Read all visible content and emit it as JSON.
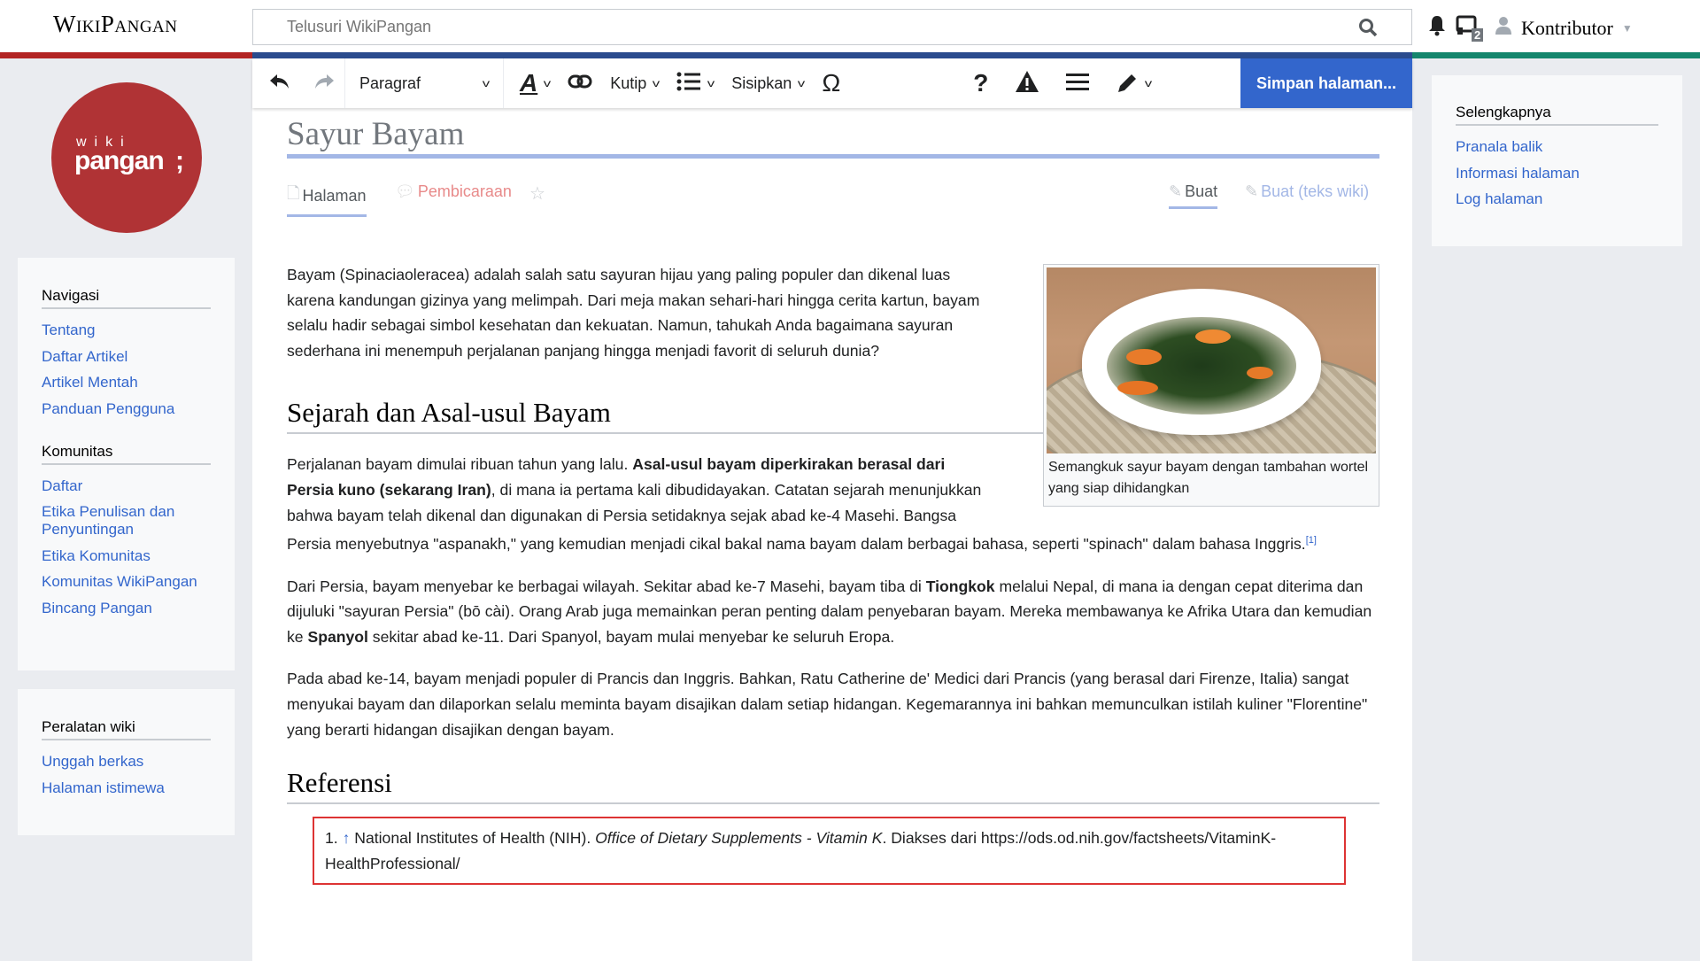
{
  "header": {
    "brand": "WikiPangan",
    "search_placeholder": "Telusuri WikiPangan",
    "notifications_count": "2",
    "username": "Kontributor"
  },
  "colors": {
    "red": "#b32424",
    "blue": "#2a4b8d",
    "green": "#14866d",
    "accent": "#3366cc"
  },
  "logo": {
    "text_top": "wiki",
    "text_main": "pangan;"
  },
  "sidebar": {
    "sections": [
      {
        "title": "Navigasi",
        "items": [
          "Tentang",
          "Daftar Artikel",
          "Artikel Mentah",
          "Panduan Pengguna"
        ]
      },
      {
        "title": "Komunitas",
        "items": [
          "Daftar",
          "Etika Penulisan dan Penyuntingan",
          "Etika Komunitas",
          "Komunitas WikiPangan",
          "Bincang Pangan"
        ]
      },
      {
        "title": "Peralatan wiki",
        "items": [
          "Unggah berkas",
          "Halaman istimewa"
        ]
      }
    ]
  },
  "right_panel": {
    "title": "Selengkapnya",
    "items": [
      "Pranala balik",
      "Informasi halaman",
      "Log halaman"
    ]
  },
  "toolbar": {
    "paragraph": "Paragraf",
    "cite": "Kutip",
    "insert": "Sisipkan",
    "save": "Simpan halaman..."
  },
  "page": {
    "title": "Sayur Bayam",
    "tabs": {
      "page": "Halaman",
      "talk": "Pembicaraan",
      "edit": "Buat",
      "edit_source": "Buat (teks wiki)"
    },
    "figure_caption": "Semangkuk sayur bayam dengan tambahan wortel yang siap dihidangkan",
    "intro": "Bayam (Spinaciaoleracea) adalah salah satu sayuran hijau yang paling populer dan dikenal luas karena kandungan gizinya yang melimpah. Dari meja makan sehari-hari hingga cerita kartun, bayam selalu hadir sebagai simbol kesehatan dan kekuatan. Namun, tahukah Anda bagaimana sayuran sederhana ini menempuh perjalanan panjang hingga menjadi favorit di seluruh dunia?",
    "h2_history": "Sejarah dan Asal-usul Bayam",
    "p1": {
      "a": "Perjalanan bayam dimulai ribuan tahun yang lalu. ",
      "b": "Asal-usul bayam diperkirakan berasal dari Persia kuno (sekarang Iran)",
      "c": ", di mana ia pertama kali dibudidayakan. Catatan sejarah menunjukkan bahwa bayam telah dikenal dan digunakan di Persia setidaknya sejak abad ke-4 Masehi. Bangsa Persia menyebutnya \"aspanakh,\" yang kemudian menjadi cikal bakal nama bayam dalam berbagai bahasa, seperti \"spinach\" dalam bahasa Inggris.",
      "ref": "[1]"
    },
    "p2": {
      "a": "Dari Persia, bayam menyebar ke berbagai wilayah. Sekitar abad ke-7 Masehi, bayam tiba di ",
      "b": "Tiongkok",
      "c": " melalui Nepal, di mana ia dengan cepat diterima dan dijuluki \"sayuran Persia\" (bō cài). Orang Arab juga memainkan peran penting dalam penyebaran bayam. Mereka membawanya ke Afrika Utara dan kemudian ke ",
      "d": "Spanyol",
      "e": " sekitar abad ke-11. Dari Spanyol, bayam mulai menyebar ke seluruh Eropa."
    },
    "p3": "Pada abad ke-14, bayam menjadi populer di Prancis dan Inggris. Bahkan, Ratu Catherine de' Medici dari Prancis (yang berasal dari Firenze, Italia) sangat menyukai bayam dan dilaporkan selalu meminta bayam disajikan dalam setiap hidangan. Kegemarannya ini bahkan memunculkan istilah kuliner \"Florentine\" yang berarti hidangan disajikan dengan bayam.",
    "h2_refs": "Referensi",
    "reference": {
      "num": "1.",
      "arrow": "↑",
      "a": "National Institutes of Health (NIH). ",
      "b": "Office of Dietary Supplements - Vitamin K",
      "c": ". Diakses dari https://ods.od.nih.gov/factsheets/VitaminK-HealthProfessional/"
    }
  }
}
